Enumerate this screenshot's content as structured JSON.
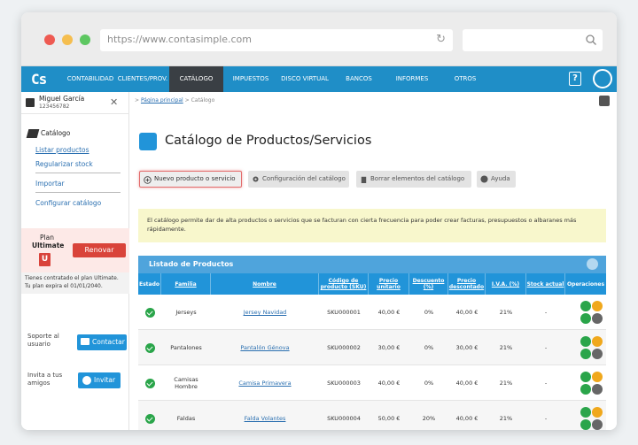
{
  "browser": {
    "url": "https://www.contasimple.com"
  },
  "nav": {
    "logo": "Cs",
    "items": [
      "CONTABILIDAD",
      "CLIENTES/PROV.",
      "CATÁLOGO",
      "IMPUESTOS",
      "DISCO VIRTUAL",
      "BANCOS",
      "INFORMES",
      "OTROS"
    ],
    "active": "CATÁLOGO",
    "help_label": "?"
  },
  "sidebar": {
    "user_name": "Miguel García",
    "user_id": "123456782",
    "section_title": "Catálogo",
    "links": [
      "Listar productos",
      "Regularizar stock",
      "Importar",
      "Configurar catálogo"
    ],
    "plan_label": "Plan",
    "plan_name": "Ultimate",
    "plan_badge": "U",
    "renew_label": "Renovar",
    "plan_info": "Tienes contratado el plan Ultimate. Tu plan expira el 01/01/2040.",
    "support_label": "Soporte al usuario",
    "contact_label": "Contactar",
    "invite_text": "Invita a tus amigos",
    "invite_label": "Invitar"
  },
  "main": {
    "breadcrumb_home": "Página principal",
    "breadcrumb_sep": ">",
    "breadcrumb_current": "Catálogo",
    "title": "Catálogo de Productos/Servicios",
    "toolbar": {
      "new_label": "Nuevo producto o servicio",
      "config_label": "Configuración del catálogo",
      "delete_label": "Borrar elementos del catálogo",
      "help_label": "Ayuda"
    },
    "notice": "El catálogo permite dar de alta productos o servicios que se facturan con cierta frecuencia para poder crear facturas, presupuestos o albaranes más rápidamente.",
    "list_title": "Listado de Productos",
    "columns": [
      "Estado",
      "Familia",
      "Nombre",
      "Código de producto (SKU)",
      "Precio unitario",
      "Descuento (%)",
      "Precio descontado",
      "I.V.A. (%)",
      "Stock actual",
      "Operaciones"
    ],
    "rows": [
      {
        "familia": "Jerseys",
        "nombre": "Jersey Navidad",
        "sku": "SKU000001",
        "precio": "40,00 €",
        "descuento": "0%",
        "descontado": "40,00 €",
        "iva": "21%",
        "stock": "-"
      },
      {
        "familia": "Pantalones",
        "nombre": "Pantalón Génova",
        "sku": "SKU000002",
        "precio": "30,00 €",
        "descuento": "0%",
        "descontado": "30,00 €",
        "iva": "21%",
        "stock": "-"
      },
      {
        "familia": "Camisas Hombre",
        "nombre": "Camisa Primavera",
        "sku": "SKU000003",
        "precio": "40,00 €",
        "descuento": "0%",
        "descontado": "40,00 €",
        "iva": "21%",
        "stock": "-"
      },
      {
        "familia": "Faldas",
        "nombre": "Falda Volantes",
        "sku": "SKU000004",
        "precio": "50,00 €",
        "descuento": "20%",
        "descontado": "40,00 €",
        "iva": "21%",
        "stock": "-"
      }
    ]
  },
  "colors": {
    "nav_blue": "#1f8ec7",
    "table_header": "#2194d9",
    "renew_red": "#d9433a",
    "ok_green": "#2aa54a"
  }
}
